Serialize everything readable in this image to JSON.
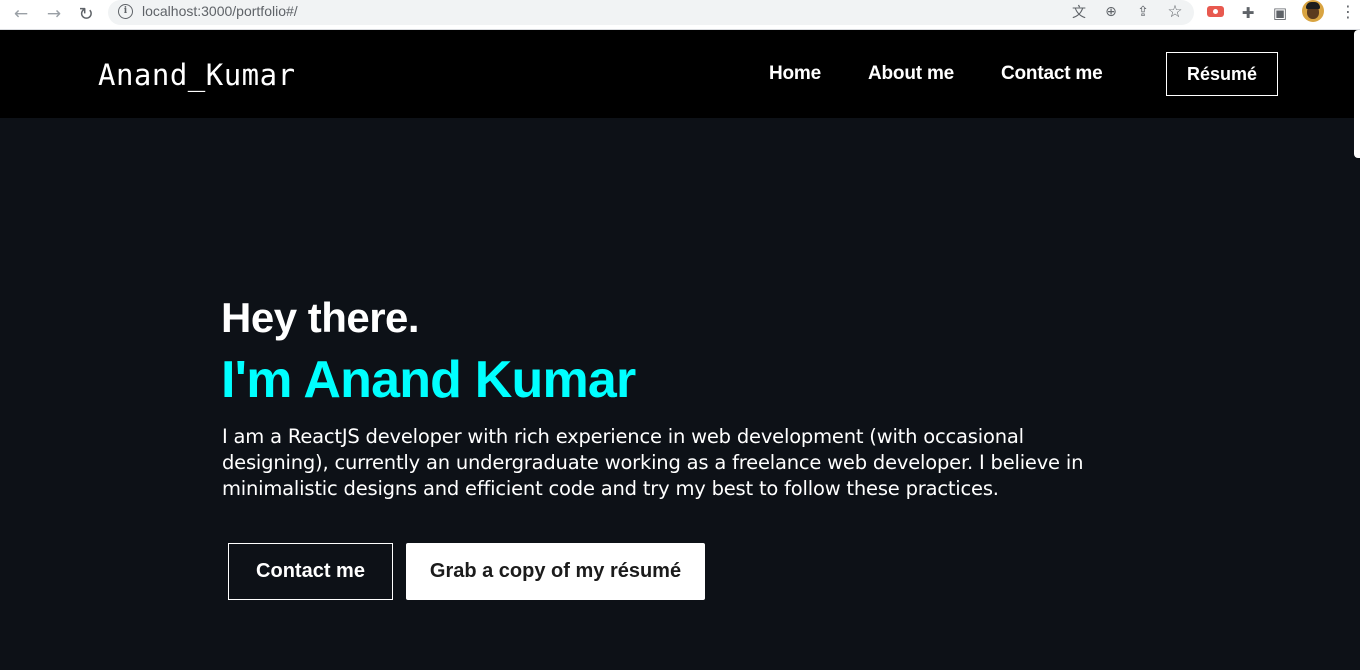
{
  "browser": {
    "back_icon": "←",
    "forward_icon": "→",
    "reload_icon": "↻",
    "info_icon": "i",
    "url": "localhost:3000/portfolio#/",
    "translate_icon": "文",
    "zoom_icon": "⊕",
    "share_icon": "⇪",
    "bookmark_icon": "☆",
    "puzzle_icon": "✚",
    "sidepanel_icon": "▣",
    "menu_icon": "⋮"
  },
  "site": {
    "brand": "Anand_Kumar",
    "nav": {
      "home": "Home",
      "about": "About me",
      "contact": "Contact me"
    },
    "resume_button": "Résumé"
  },
  "hero": {
    "greeting": "Hey there.",
    "name": "I'm Anand Kumar",
    "description": "I am a ReactJS developer with rich experience in web development (with occasional designing), currently an undergraduate working as a freelance web developer. I believe in minimalistic designs and efficient code and try my best to follow these practices.",
    "contact_button": "Contact me",
    "resume_button": "Grab a copy of my résumé"
  },
  "colors": {
    "page_bg": "#0d1117",
    "navbar_bg": "#000000",
    "accent": "#00ffff",
    "text": "#ffffff"
  }
}
